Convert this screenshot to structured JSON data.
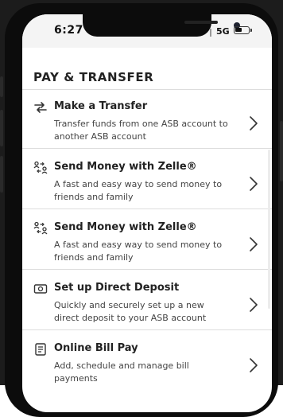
{
  "status_bar": {
    "time": "6:27",
    "network": "5G"
  },
  "section_heading": "PAY & TRANSFER",
  "items": [
    {
      "icon": "transfer-arrows-icon",
      "title": "Make a Transfer",
      "description": "Transfer funds from one ASB account to another ASB account"
    },
    {
      "icon": "zelle-send-money-icon",
      "title": "Send Money with Zelle®",
      "description": "A fast and easy way to send money to friends and family"
    },
    {
      "icon": "zelle-send-money-icon",
      "title": "Send Money with Zelle®",
      "description": "A fast and easy way to send money to friends and family"
    },
    {
      "icon": "direct-deposit-icon",
      "title": "Set up Direct Deposit",
      "description": "Quickly and securely set up a new direct deposit to your ASB account"
    },
    {
      "icon": "bill-pay-icon",
      "title": "Online Bill Pay",
      "description": "Add, schedule and manage bill payments"
    }
  ],
  "colors": {
    "text_primary": "#222222",
    "text_secondary": "#444444",
    "divider": "#dddddd",
    "background": "#ffffff"
  }
}
